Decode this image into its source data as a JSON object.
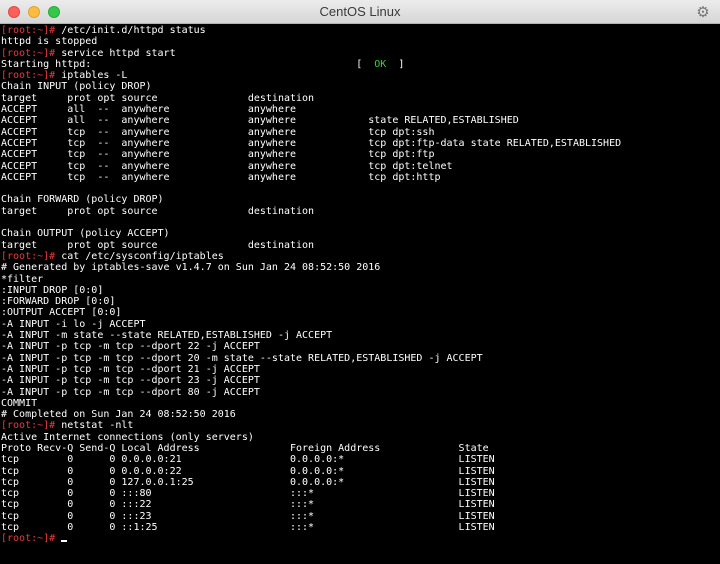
{
  "window": {
    "title": "CentOS Linux",
    "settings_icon": "gear-icon"
  },
  "colors": {
    "prompt": "#e83a3a",
    "ok": "#36d636",
    "text": "#ffffff",
    "background": "#000000"
  },
  "terminal": {
    "prompt": "[root:~]#",
    "lines": [
      {
        "p": "[root:~]#",
        "t": " /etc/init.d/httpd status"
      },
      {
        "t": "httpd is stopped"
      },
      {
        "p": "[root:~]#",
        "t": " service httpd start"
      },
      {
        "t": "Starting httpd:                                            [  ",
        "ok": "OK",
        "t2": "  ]"
      },
      {
        "p": "[root:~]#",
        "t": " iptables -L"
      },
      {
        "t": "Chain INPUT (policy DROP)"
      },
      {
        "t": "target     prot opt source               destination"
      },
      {
        "t": "ACCEPT     all  --  anywhere             anywhere"
      },
      {
        "t": "ACCEPT     all  --  anywhere             anywhere            state RELATED,ESTABLISHED"
      },
      {
        "t": "ACCEPT     tcp  --  anywhere             anywhere            tcp dpt:ssh"
      },
      {
        "t": "ACCEPT     tcp  --  anywhere             anywhere            tcp dpt:ftp-data state RELATED,ESTABLISHED"
      },
      {
        "t": "ACCEPT     tcp  --  anywhere             anywhere            tcp dpt:ftp"
      },
      {
        "t": "ACCEPT     tcp  --  anywhere             anywhere            tcp dpt:telnet"
      },
      {
        "t": "ACCEPT     tcp  --  anywhere             anywhere            tcp dpt:http"
      },
      {
        "t": ""
      },
      {
        "t": "Chain FORWARD (policy DROP)"
      },
      {
        "t": "target     prot opt source               destination"
      },
      {
        "t": ""
      },
      {
        "t": "Chain OUTPUT (policy ACCEPT)"
      },
      {
        "t": "target     prot opt source               destination"
      },
      {
        "p": "[root:~]#",
        "t": " cat /etc/sysconfig/iptables"
      },
      {
        "t": "# Generated by iptables-save v1.4.7 on Sun Jan 24 08:52:50 2016"
      },
      {
        "t": "*filter"
      },
      {
        "t": ":INPUT DROP [0:0]"
      },
      {
        "t": ":FORWARD DROP [0:0]"
      },
      {
        "t": ":OUTPUT ACCEPT [0:0]"
      },
      {
        "t": "-A INPUT -i lo -j ACCEPT"
      },
      {
        "t": "-A INPUT -m state --state RELATED,ESTABLISHED -j ACCEPT"
      },
      {
        "t": "-A INPUT -p tcp -m tcp --dport 22 -j ACCEPT"
      },
      {
        "t": "-A INPUT -p tcp -m tcp --dport 20 -m state --state RELATED,ESTABLISHED -j ACCEPT"
      },
      {
        "t": "-A INPUT -p tcp -m tcp --dport 21 -j ACCEPT"
      },
      {
        "t": "-A INPUT -p tcp -m tcp --dport 23 -j ACCEPT"
      },
      {
        "t": "-A INPUT -p tcp -m tcp --dport 80 -j ACCEPT"
      },
      {
        "t": "COMMIT"
      },
      {
        "t": "# Completed on Sun Jan 24 08:52:50 2016"
      },
      {
        "p": "[root:~]#",
        "t": " netstat -nlt"
      },
      {
        "t": "Active Internet connections (only servers)"
      },
      {
        "t": "Proto Recv-Q Send-Q Local Address               Foreign Address             State"
      },
      {
        "t": "tcp        0      0 0.0.0.0:21                  0.0.0.0:*                   LISTEN"
      },
      {
        "t": "tcp        0      0 0.0.0.0:22                  0.0.0.0:*                   LISTEN"
      },
      {
        "t": "tcp        0      0 127.0.0.1:25                0.0.0.0:*                   LISTEN"
      },
      {
        "t": "tcp        0      0 :::80                       :::*                        LISTEN"
      },
      {
        "t": "tcp        0      0 :::22                       :::*                        LISTEN"
      },
      {
        "t": "tcp        0      0 :::23                       :::*                        LISTEN"
      },
      {
        "t": "tcp        0      0 ::1:25                      :::*                        LISTEN"
      },
      {
        "p": "[root:~]#",
        "t": " ",
        "cursor": true
      }
    ]
  }
}
